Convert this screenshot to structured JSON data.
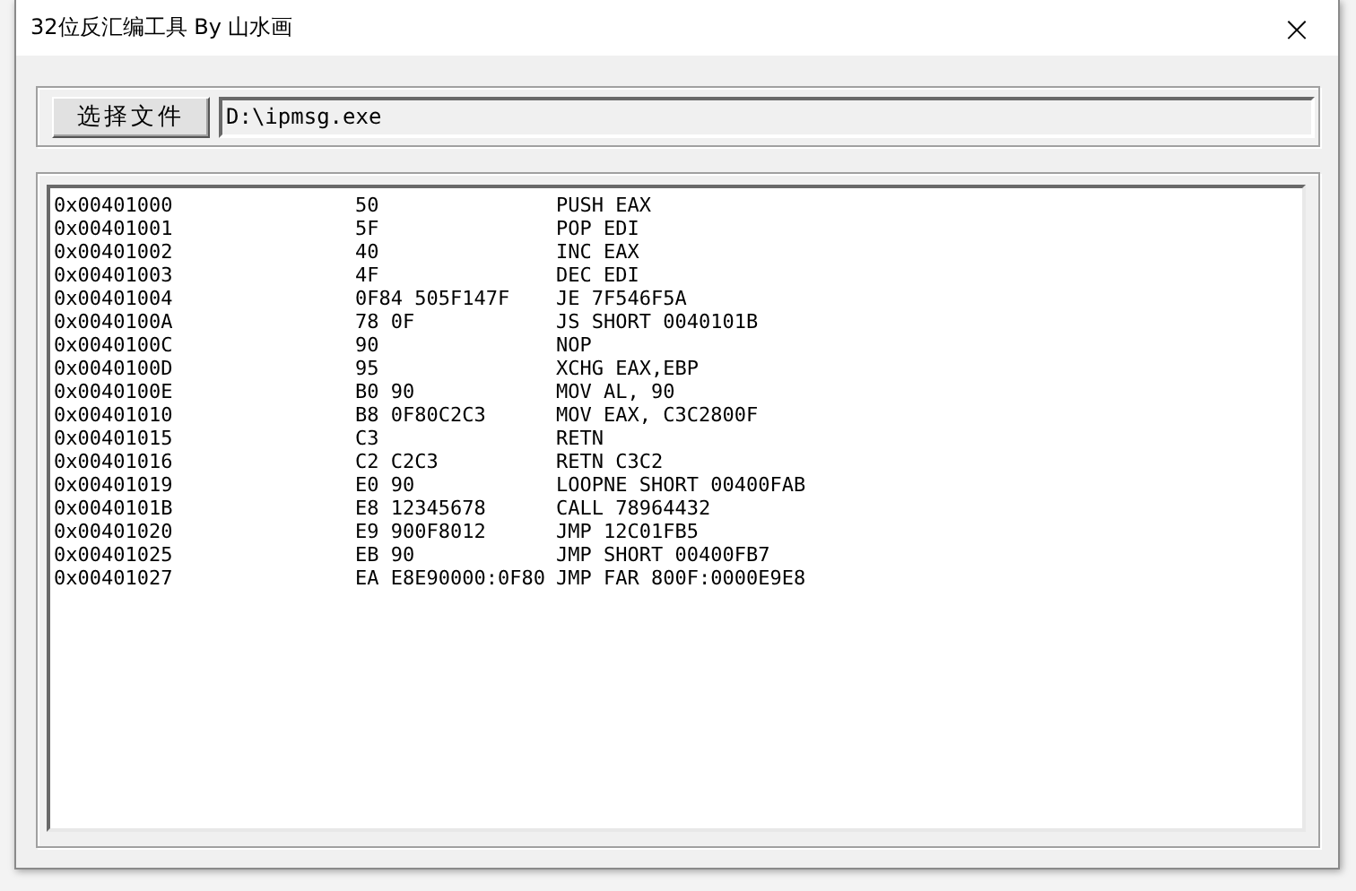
{
  "window": {
    "title": "32位反汇编工具  By 山水画",
    "close": "×"
  },
  "file_bar": {
    "button": "选择文件",
    "path": "D:\\ipmsg.exe"
  },
  "listing": [
    {
      "address": "0x00401000",
      "bytes": "50",
      "instruction": "PUSH EAX"
    },
    {
      "address": "0x00401001",
      "bytes": "5F",
      "instruction": "POP EDI"
    },
    {
      "address": "0x00401002",
      "bytes": "40",
      "instruction": "INC EAX"
    },
    {
      "address": "0x00401003",
      "bytes": "4F",
      "instruction": "DEC EDI"
    },
    {
      "address": "0x00401004",
      "bytes": "0F84 505F147F",
      "instruction": "JE 7F546F5A"
    },
    {
      "address": "0x0040100A",
      "bytes": "78 0F",
      "instruction": "JS SHORT 0040101B"
    },
    {
      "address": "0x0040100C",
      "bytes": "90",
      "instruction": "NOP"
    },
    {
      "address": "0x0040100D",
      "bytes": "95",
      "instruction": "XCHG EAX,EBP"
    },
    {
      "address": "0x0040100E",
      "bytes": "B0 90",
      "instruction": "MOV AL, 90"
    },
    {
      "address": "0x00401010",
      "bytes": "B8 0F80C2C3",
      "instruction": "MOV EAX, C3C2800F"
    },
    {
      "address": "0x00401015",
      "bytes": "C3",
      "instruction": "RETN"
    },
    {
      "address": "0x00401016",
      "bytes": "C2 C2C3",
      "instruction": "RETN C3C2"
    },
    {
      "address": "0x00401019",
      "bytes": "E0 90",
      "instruction": "LOOPNE SHORT 00400FAB"
    },
    {
      "address": "0x0040101B",
      "bytes": "E8 12345678",
      "instruction": "CALL 78964432"
    },
    {
      "address": "0x00401020",
      "bytes": "E9 900F8012",
      "instruction": "JMP 12C01FB5"
    },
    {
      "address": "0x00401025",
      "bytes": "EB 90",
      "instruction": "JMP SHORT 00400FB7"
    },
    {
      "address": "0x00401027",
      "bytes": "EA E8E90000:0F80",
      "instruction": "JMP FAR 800F:0000E9E8"
    }
  ]
}
